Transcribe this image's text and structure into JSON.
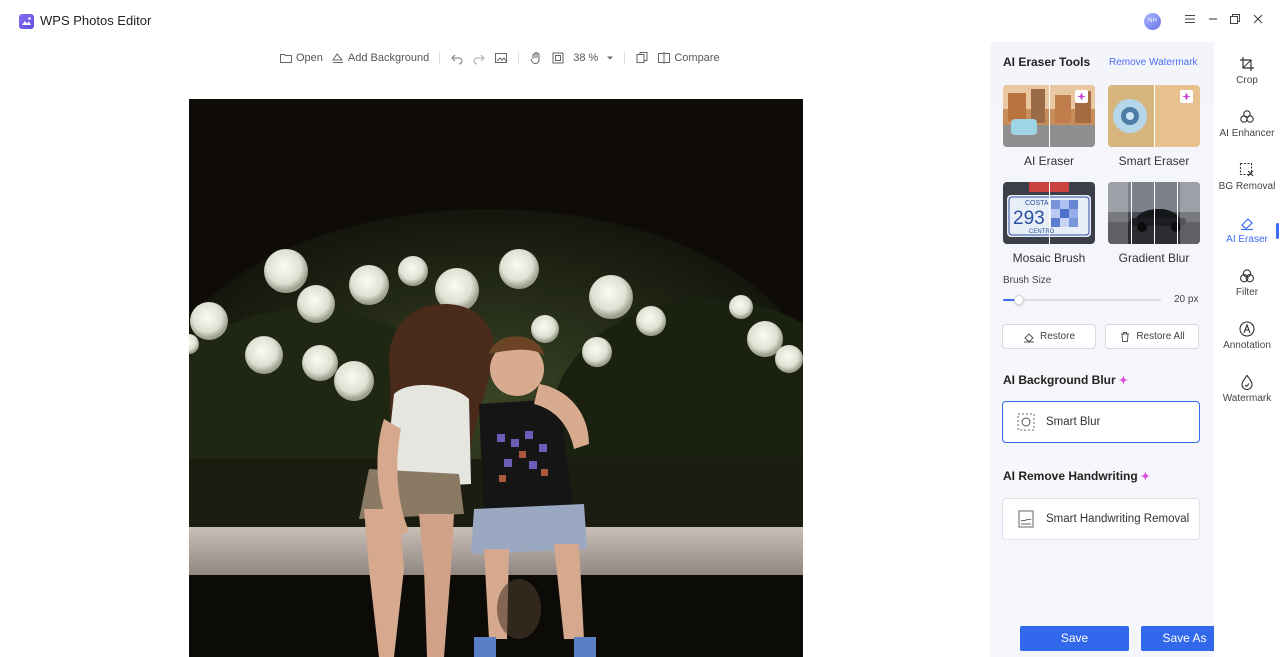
{
  "app": {
    "title": "WPS Photos Editor",
    "avatar_initials": "NH"
  },
  "toolbar": {
    "open": "Open",
    "add_background": "Add Background",
    "zoom": "38 %",
    "compare": "Compare"
  },
  "panel": {
    "title": "AI Eraser Tools",
    "remove_watermark": "Remove Watermark",
    "tools": [
      {
        "label": "AI Eraser"
      },
      {
        "label": "Smart Eraser"
      },
      {
        "label": "Mosaic Brush"
      },
      {
        "label": "Gradient Blur"
      }
    ],
    "brush_size_label": "Brush Size",
    "brush_size_value": "20 px",
    "brush_size_level": 0.1,
    "restore": "Restore",
    "restore_all": "Restore All",
    "bg_blur_title": "AI Background Blur",
    "smart_blur": "Smart Blur",
    "handwriting_title": "AI Remove Handwriting",
    "smart_handwriting": "Smart Handwriting Removal",
    "save": "Save",
    "save_as": "Save As",
    "mosaic_thumb_text": {
      "line1": "COSTA",
      "line2": "293",
      "line3": "CENTRO"
    }
  },
  "rail": {
    "items": [
      {
        "label": "Crop"
      },
      {
        "label": "AI Enhancer"
      },
      {
        "label": "BG Removal"
      },
      {
        "label": "AI Eraser"
      },
      {
        "label": "Filter"
      },
      {
        "label": "Annotation"
      },
      {
        "label": "Watermark"
      }
    ],
    "active": "AI Eraser"
  },
  "colors": {
    "accent": "#3268ec",
    "sparkle": "#d64bd9",
    "link": "#4d6ef5"
  }
}
